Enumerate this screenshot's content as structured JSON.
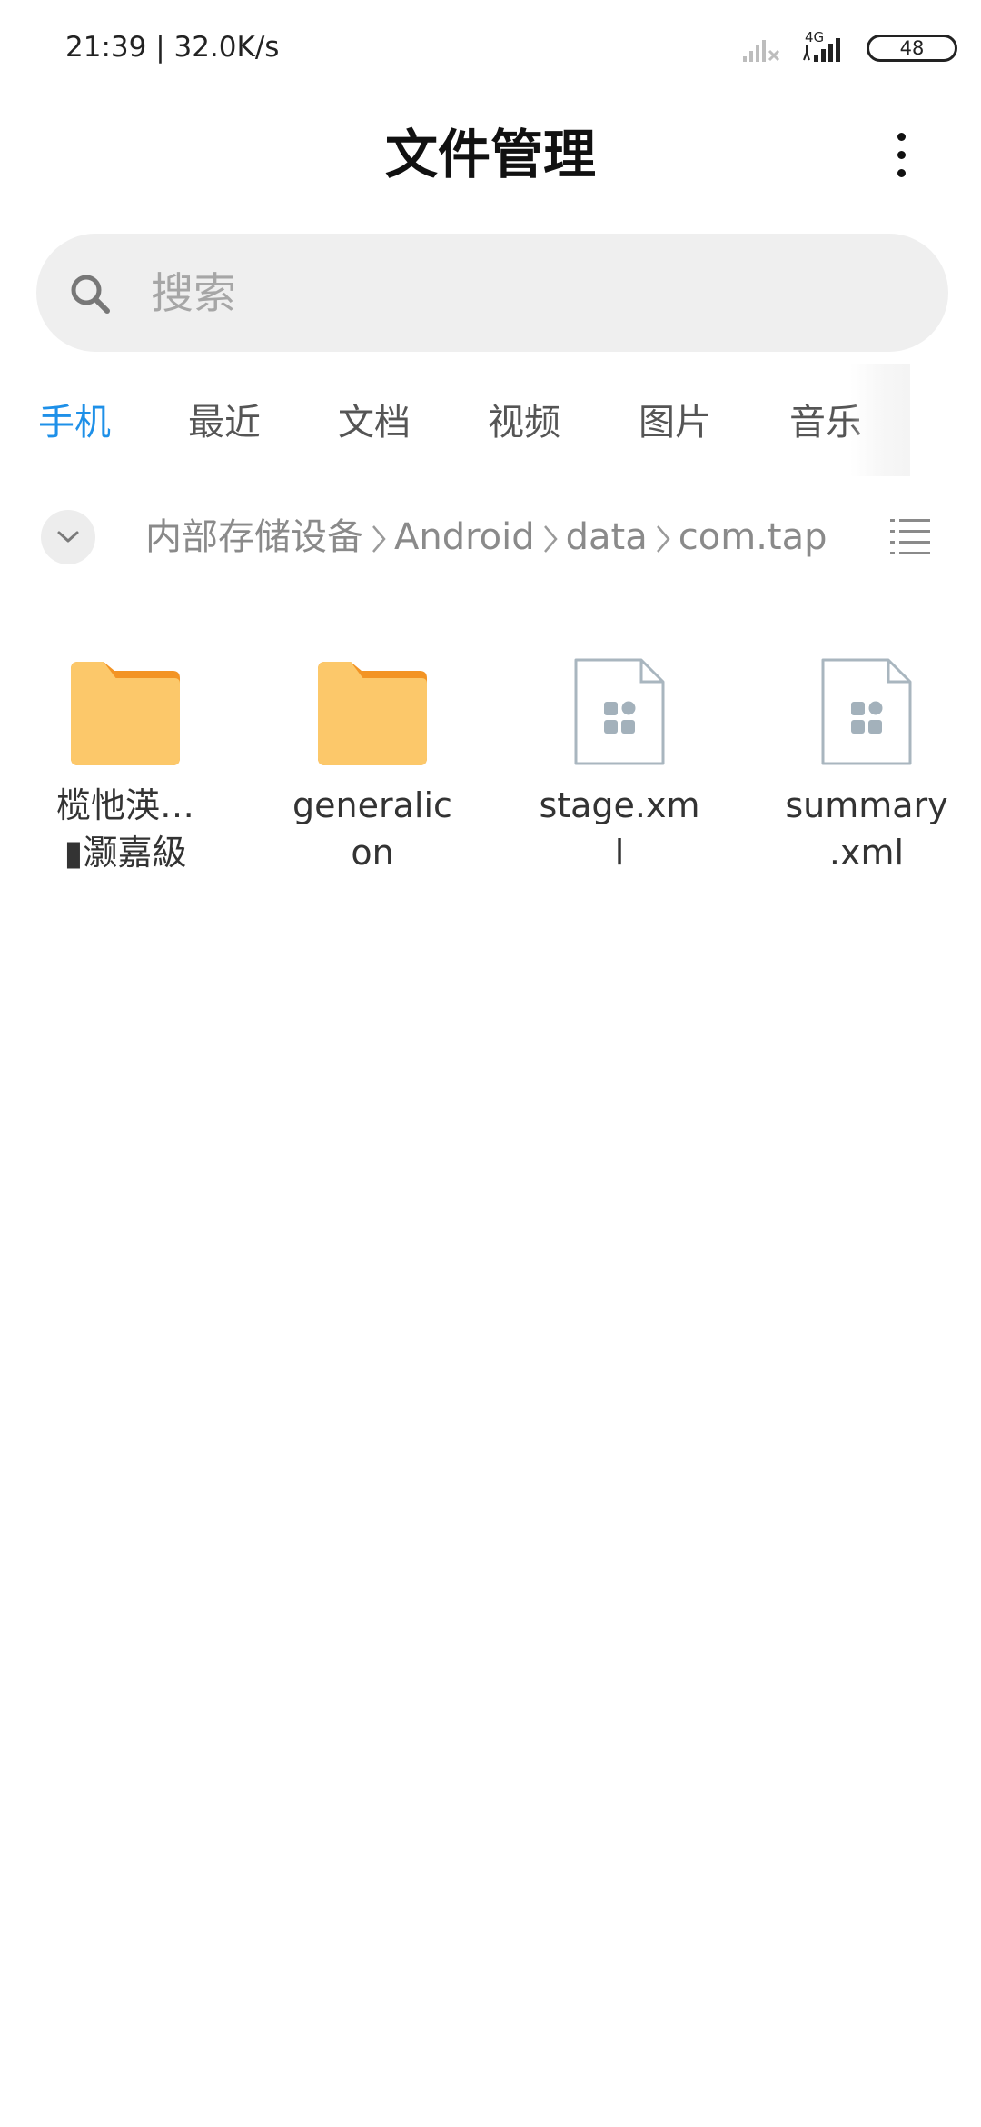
{
  "status_bar": {
    "time": "21:39 | 32.0K/s",
    "network_label": "4G",
    "battery": "48"
  },
  "header": {
    "title": "文件管理"
  },
  "search": {
    "placeholder": "搜索"
  },
  "tabs": [
    {
      "label": "手机",
      "active": true
    },
    {
      "label": "最近",
      "active": false
    },
    {
      "label": "文档",
      "active": false
    },
    {
      "label": "视频",
      "active": false
    },
    {
      "label": "图片",
      "active": false
    },
    {
      "label": "音乐",
      "active": false
    }
  ],
  "breadcrumb": {
    "items": [
      "内部存储设备",
      "Android",
      "data",
      "com.tap"
    ]
  },
  "files": [
    {
      "name_lines": [
        "榄忚渶…",
        "▮灏嘉級"
      ],
      "type": "folder"
    },
    {
      "name_lines": [
        "generalic",
        "on"
      ],
      "type": "folder"
    },
    {
      "name_lines": [
        "stage.xm",
        "l"
      ],
      "type": "file"
    },
    {
      "name_lines": [
        "summary",
        ".xml"
      ],
      "type": "file"
    }
  ],
  "colors": {
    "accent": "#1e90e8",
    "folder": "#fcc86a",
    "folder_tab": "#f39424",
    "file_outline": "#a9b6bf"
  }
}
